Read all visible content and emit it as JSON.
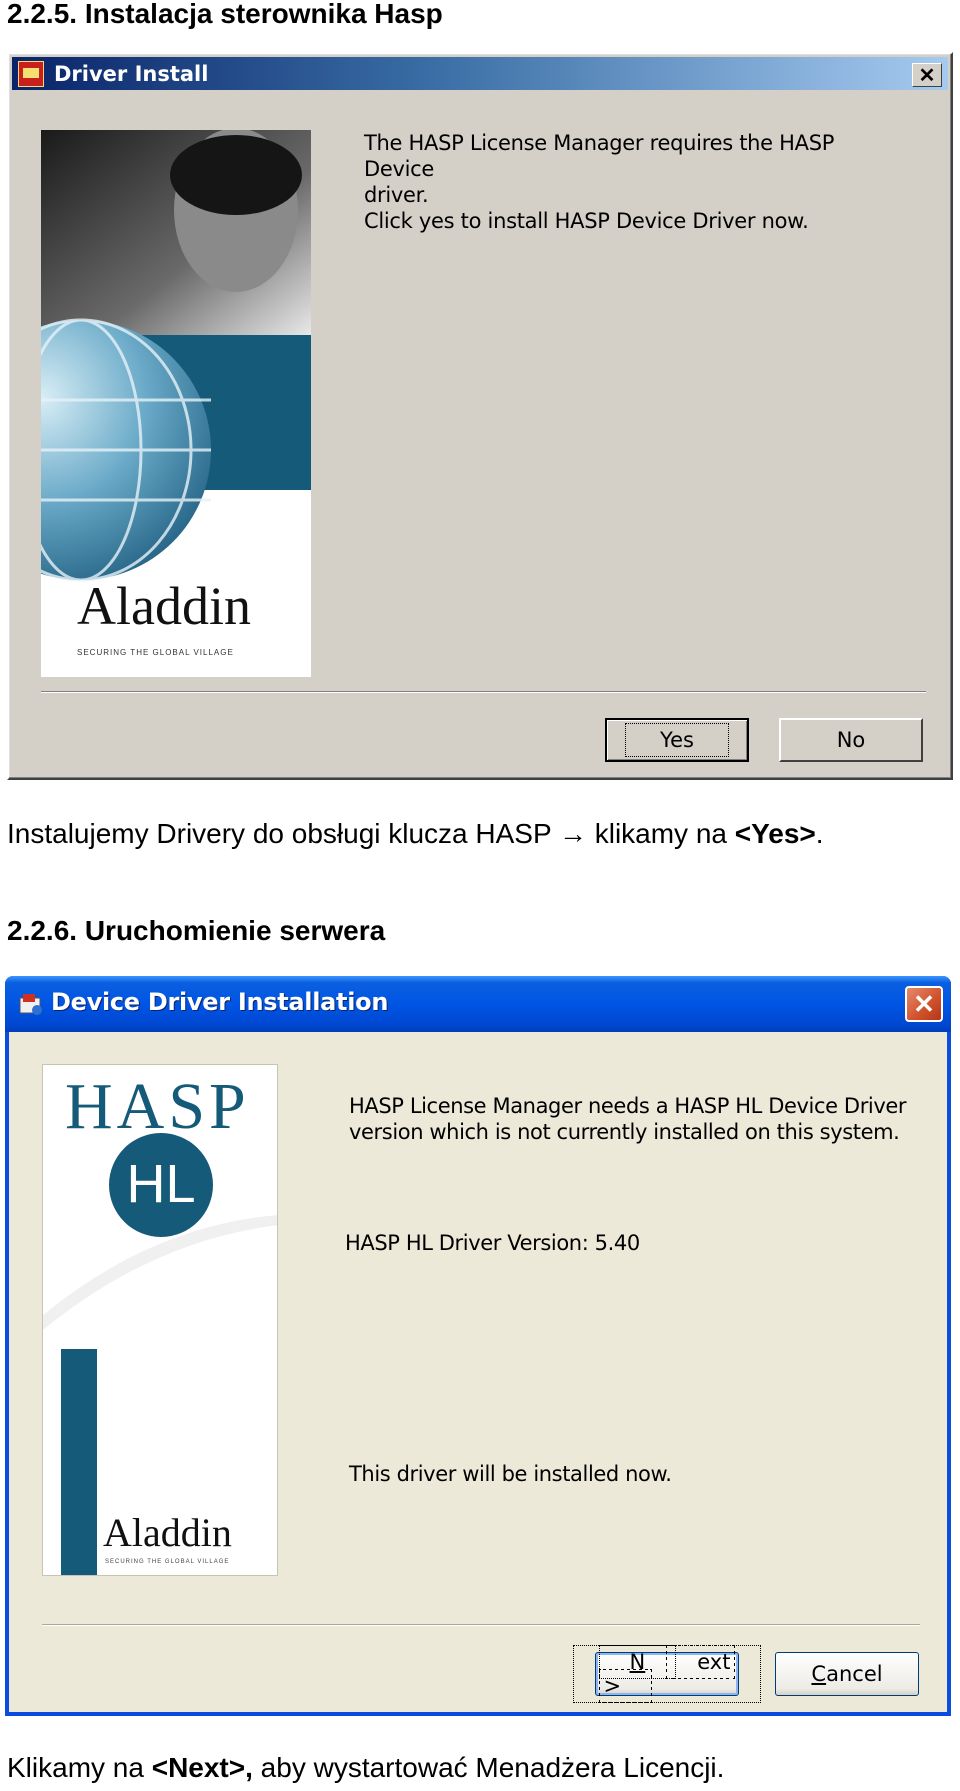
{
  "section1": {
    "heading": "2.2.5.  Instalacja sterownika Hasp",
    "dialog": {
      "title": "Driver Install",
      "close_label": "✕",
      "message_line1": "The HASP License Manager requires the HASP Device",
      "message_line2": "driver.",
      "message_line3": "Click yes to install HASP Device Driver now.",
      "brand": "Aladdin",
      "tagline": "SECURING THE GLOBAL VILLAGE",
      "yes_label": "Yes",
      "no_label": "No"
    },
    "caption_prefix": "Instalujemy Drivery do obsługi klucza HASP",
    "caption_arrow": "→",
    "caption_middle": " klikamy na ",
    "caption_bold": "<Yes>",
    "caption_suffix": "."
  },
  "section2": {
    "heading": "2.2.6.  Uruchomienie serwera",
    "dialog": {
      "title": "Device Driver Installation",
      "close_label": "✕",
      "message_line1": "HASP License Manager needs a HASP HL Device Driver",
      "message_line2": "version which is not currently installed on this system.",
      "version_text": "HASP HL Driver Version: 5.40",
      "install_text": "This driver will be installed now.",
      "logo_hasp": "HASP",
      "logo_hl": "HL",
      "brand": "Aladdin",
      "tagline": "SECURING THE GLOBAL VILLAGE",
      "next_key": "N",
      "next_rest": "ext >",
      "cancel_key": "C",
      "cancel_rest": "ancel"
    },
    "caption_prefix": "Klikamy na ",
    "caption_bold": "<Next>,",
    "caption_suffix": " aby wystartować Menadżera Licencji."
  },
  "colors": {
    "classic_face": "#d4d0c8",
    "xp_face": "#ece9d8",
    "xp_title": "#0055e5",
    "teal": "#155a78"
  }
}
